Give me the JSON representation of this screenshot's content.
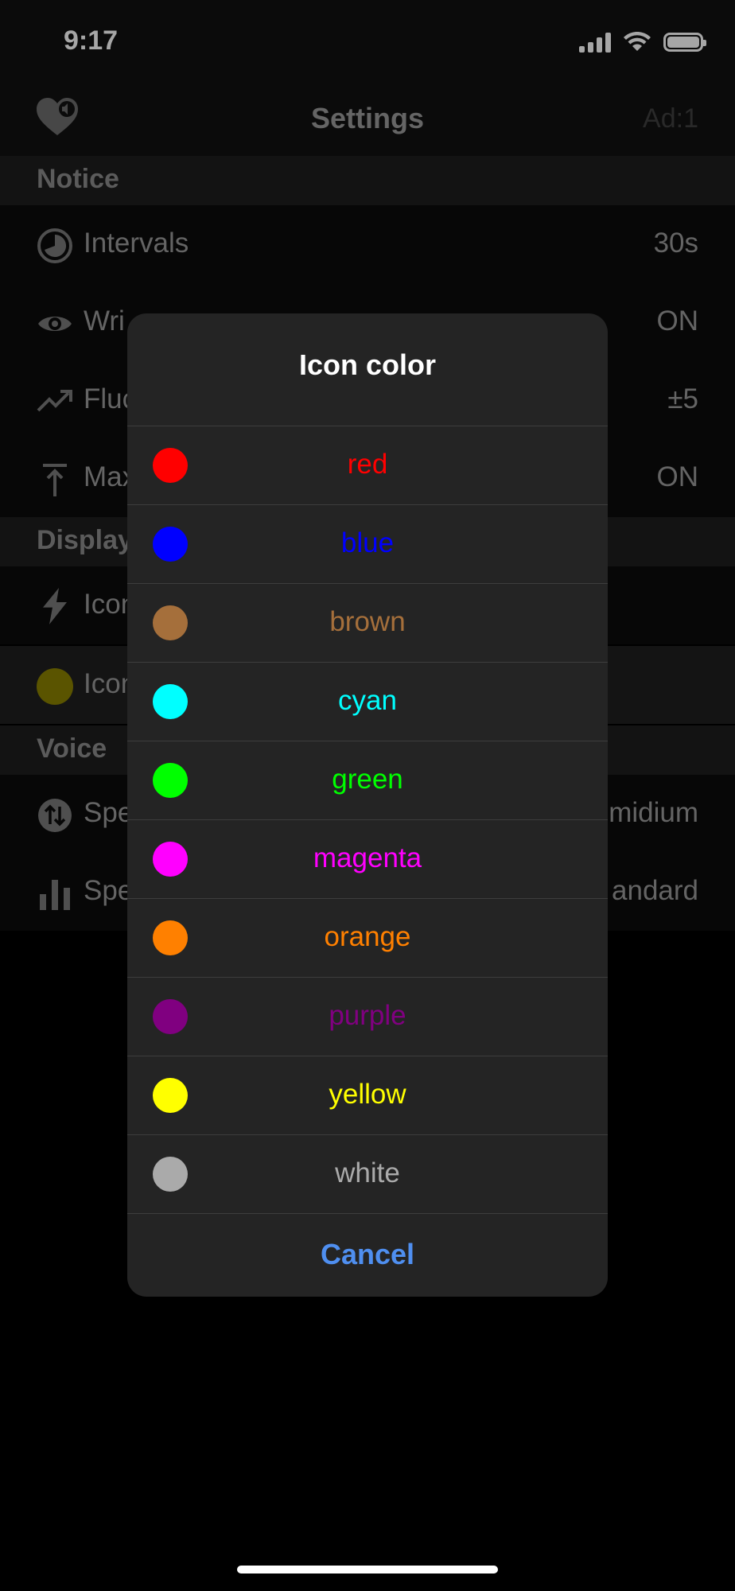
{
  "status_bar": {
    "time": "9:17"
  },
  "nav": {
    "title": "Settings",
    "right": "Ad:1"
  },
  "sections": {
    "notice": "Notice",
    "display": "Display",
    "voice": "Voice"
  },
  "rows": {
    "intervals": {
      "label": "Intervals",
      "value": "30s"
    },
    "wrist": {
      "label": "Wri",
      "value": "ON"
    },
    "fluc": {
      "label": "Fluc",
      "value": "±5"
    },
    "max": {
      "label": "Max",
      "value": "ON"
    },
    "icon1": {
      "label": "Icon"
    },
    "icon2": {
      "label": "Icon",
      "swatch": "#8a8200"
    },
    "speed": {
      "label": "Spe",
      "value": "midium"
    },
    "speaker": {
      "label": "Spe",
      "value": "andard"
    }
  },
  "sheet": {
    "title": "Icon color",
    "options": [
      {
        "label": "red",
        "color": "#ff0000"
      },
      {
        "label": "blue",
        "color": "#0000ff"
      },
      {
        "label": "brown",
        "color": "#a56f3b"
      },
      {
        "label": "cyan",
        "color": "#00ffff"
      },
      {
        "label": "green",
        "color": "#00ff00"
      },
      {
        "label": "magenta",
        "color": "#ff00ff"
      },
      {
        "label": "orange",
        "color": "#ff8000"
      },
      {
        "label": "purple",
        "color": "#800080"
      },
      {
        "label": "yellow",
        "color": "#ffff00"
      },
      {
        "label": "white",
        "color": "#aaaaaa"
      }
    ],
    "cancel": "Cancel"
  }
}
